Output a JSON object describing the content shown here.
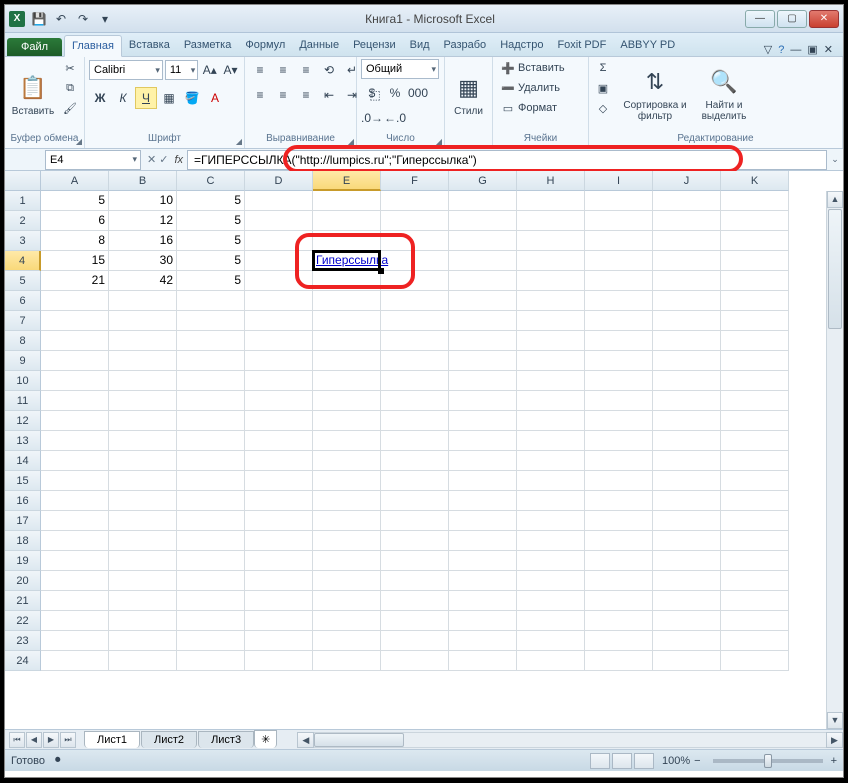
{
  "title": "Книга1 - Microsoft Excel",
  "qat": {
    "excel_label": "X"
  },
  "tabs": {
    "file": "Файл",
    "items": [
      "Главная",
      "Вставка",
      "Разметка",
      "Формул",
      "Данные",
      "Рецензи",
      "Вид",
      "Разрабо",
      "Надстро",
      "Foxit PDF",
      "ABBYY PD"
    ],
    "active_index": 0
  },
  "ribbon": {
    "clipboard": {
      "paste": "Вставить",
      "label": "Буфер обмена"
    },
    "font": {
      "name": "Calibri",
      "size": "11",
      "label": "Шрифт"
    },
    "align": {
      "label": "Выравнивание"
    },
    "number": {
      "format": "Общий",
      "label": "Число"
    },
    "styles": {
      "btn": "Стили",
      "label": ""
    },
    "cells": {
      "insert": "Вставить",
      "delete": "Удалить",
      "format": "Формат",
      "label": "Ячейки"
    },
    "editing": {
      "sort": "Сортировка и фильтр",
      "find": "Найти и выделить",
      "label": "Редактирование"
    }
  },
  "namebox": "E4",
  "formula": "=ГИПЕРССЫЛКА(\"http://lumpics.ru\";\"Гиперссылка\")",
  "columns": [
    "A",
    "B",
    "C",
    "D",
    "E",
    "F",
    "G",
    "H",
    "I",
    "J",
    "K"
  ],
  "selected_col_index": 4,
  "row_count": 24,
  "selected_row": 4,
  "cells": {
    "r1": {
      "A": "5",
      "B": "10",
      "C": "5"
    },
    "r2": {
      "A": "6",
      "B": "12",
      "C": "5"
    },
    "r3": {
      "A": "8",
      "B": "16",
      "C": "5"
    },
    "r4": {
      "A": "15",
      "B": "30",
      "C": "5",
      "E": "Гиперссылка"
    },
    "r5": {
      "A": "21",
      "B": "42",
      "C": "5"
    }
  },
  "sheet_tabs": [
    "Лист1",
    "Лист2",
    "Лист3"
  ],
  "active_sheet": 0,
  "status": {
    "ready": "Готово",
    "zoom": "100%"
  },
  "chart_data": {
    "type": "table",
    "columns": [
      "A",
      "B",
      "C"
    ],
    "rows": [
      [
        5,
        10,
        5
      ],
      [
        6,
        12,
        5
      ],
      [
        8,
        16,
        5
      ],
      [
        15,
        30,
        5
      ],
      [
        21,
        42,
        5
      ]
    ]
  }
}
